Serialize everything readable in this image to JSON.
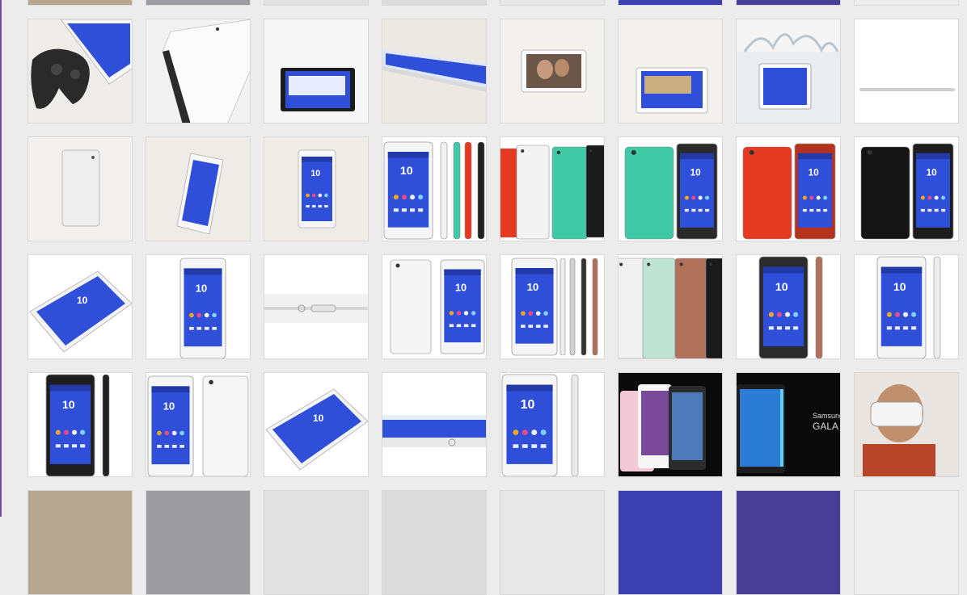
{
  "page": {
    "title": "",
    "rail_color": "#6d4f9e"
  },
  "colors": {
    "screen_blue": "#2f4fd8",
    "phone_white": "#f4f4f4",
    "phone_black": "#1b1b1b",
    "phone_red": "#e43a22",
    "phone_mint": "#3fc9a4",
    "phone_copper": "#b0705a"
  },
  "tiles": [
    {
      "name": "thumb-r0-c0",
      "icon": "partial-image"
    },
    {
      "name": "thumb-r0-c1",
      "icon": "partial-image"
    },
    {
      "name": "thumb-r0-c2",
      "icon": "partial-image"
    },
    {
      "name": "thumb-r0-c3",
      "icon": "partial-image"
    },
    {
      "name": "thumb-r0-c4",
      "icon": "partial-image"
    },
    {
      "name": "thumb-r0-c5",
      "icon": "partial-image"
    },
    {
      "name": "thumb-r0-c6",
      "icon": "partial-image"
    },
    {
      "name": "thumb-r0-c7",
      "icon": "partial-image"
    },
    {
      "name": "thumb-tablet-controller",
      "icon": "tablet-with-gamepad"
    },
    {
      "name": "thumb-tablet-edge",
      "icon": "tablet-edge-angle"
    },
    {
      "name": "thumb-tablet-black-landscape",
      "icon": "tablet-landscape-black"
    },
    {
      "name": "thumb-tablet-thin-side",
      "icon": "tablet-thin-side"
    },
    {
      "name": "thumb-tablet-photo",
      "icon": "tablet-photo-landscape"
    },
    {
      "name": "thumb-tablet-white-landscape",
      "icon": "tablet-landscape-white"
    },
    {
      "name": "thumb-tablet-water-splash",
      "icon": "tablet-water-splash"
    },
    {
      "name": "thumb-tablet-profile",
      "icon": "tablet-profile"
    },
    {
      "name": "thumb-tablet-back",
      "icon": "tablet-back-white"
    },
    {
      "name": "thumb-tablet-tilted",
      "icon": "tablet-tilted"
    },
    {
      "name": "thumb-tablet-front",
      "icon": "tablet-front-white"
    },
    {
      "name": "thumb-phone-colors",
      "icon": "phone-with-side-colors"
    },
    {
      "name": "thumb-phones-red-white-mint",
      "icon": "phones-red-white-mint"
    },
    {
      "name": "thumb-phones-mint",
      "icon": "phones-mint"
    },
    {
      "name": "thumb-phones-red",
      "icon": "phones-red"
    },
    {
      "name": "thumb-phones-black",
      "icon": "phones-black"
    },
    {
      "name": "thumb-phone-angled-white",
      "icon": "phone-angled-white"
    },
    {
      "name": "thumb-phone-front-white",
      "icon": "phone-front-white"
    },
    {
      "name": "thumb-phone-side-detail",
      "icon": "phone-side-detail"
    },
    {
      "name": "thumb-phones-white-pair",
      "icon": "phones-white-pair"
    },
    {
      "name": "thumb-phone-with-sides",
      "icon": "phone-with-sides"
    },
    {
      "name": "thumb-phones-backs",
      "icon": "phones-backs"
    },
    {
      "name": "thumb-phone-copper",
      "icon": "phone-copper"
    },
    {
      "name": "thumb-phone-white-side",
      "icon": "phone-white-side"
    },
    {
      "name": "thumb-phone-black-side",
      "icon": "phone-black-side"
    },
    {
      "name": "thumb-phones-white-back",
      "icon": "phones-white-back"
    },
    {
      "name": "thumb-phone-angled-white-2",
      "icon": "phone-angled-white"
    },
    {
      "name": "thumb-phone-edge-detail",
      "icon": "phone-edge-detail"
    },
    {
      "name": "thumb-phone-white-slim",
      "icon": "phone-white-slim"
    },
    {
      "name": "thumb-galaxy-note-pair",
      "icon": "galaxy-note-pair"
    },
    {
      "name": "thumb-galaxy-edge",
      "icon": "galaxy-edge"
    },
    {
      "name": "thumb-gear-vr-person",
      "icon": "gear-vr-person"
    },
    {
      "name": "thumb-r6-c0",
      "icon": "partial-image"
    },
    {
      "name": "thumb-r6-c1",
      "icon": "partial-image"
    },
    {
      "name": "thumb-r6-c2",
      "icon": "partial-image"
    },
    {
      "name": "thumb-r6-c3",
      "icon": "partial-image"
    },
    {
      "name": "thumb-r6-c4",
      "icon": "partial-image"
    },
    {
      "name": "thumb-r6-c5",
      "icon": "partial-image"
    },
    {
      "name": "thumb-r6-c6",
      "icon": "partial-image"
    },
    {
      "name": "thumb-r6-c7",
      "icon": "partial-image"
    }
  ],
  "galaxy_edge_text": "Samsung GALA"
}
